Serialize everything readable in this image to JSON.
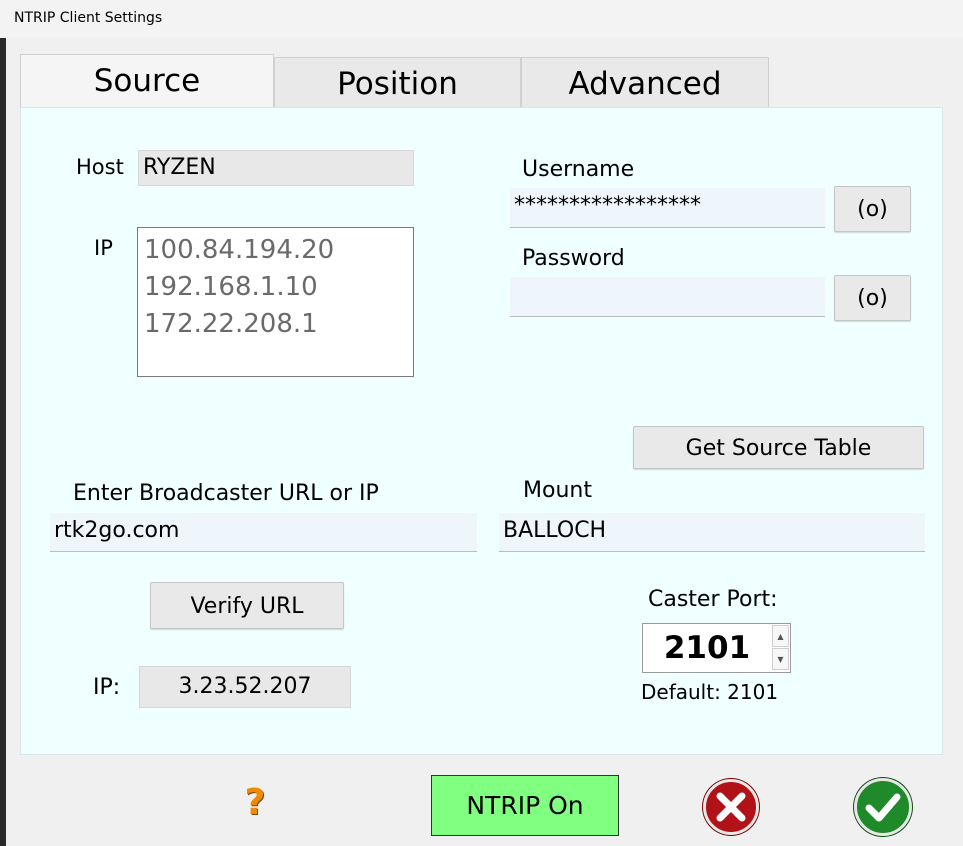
{
  "window": {
    "title": "NTRIP Client Settings"
  },
  "tabs": [
    {
      "label": "Source",
      "active": true
    },
    {
      "label": "Position",
      "active": false
    },
    {
      "label": "Advanced",
      "active": false
    }
  ],
  "source": {
    "host_label": "Host",
    "host_value": "RYZEN",
    "ip_label": "IP",
    "ip_list": [
      "100.84.194.20",
      "192.168.1.10",
      "172.22.208.1"
    ],
    "username_label": "Username",
    "username_value": "*****************",
    "password_label": "Password",
    "password_value": "",
    "reveal_label": "(o)",
    "get_source_table_label": "Get Source Table",
    "broadcaster_label": "Enter Broadcaster URL or IP",
    "broadcaster_value": "rtk2go.com",
    "mount_label": "Mount",
    "mount_value": "BALLOCH",
    "verify_url_label": "Verify URL",
    "resolved_ip_label": "IP:",
    "resolved_ip_value": "3.23.52.207",
    "caster_port_label": "Caster Port:",
    "caster_port_value": "2101",
    "caster_port_default": "Default: 2101"
  },
  "footer": {
    "help_glyph": "?",
    "ntrip_button_label": "NTRIP On",
    "cancel_icon": "red-x-circle-icon",
    "ok_icon": "green-check-circle-icon"
  },
  "colors": {
    "panel_bg": "#f0ffff",
    "ntrip_on_bg": "#80ff80",
    "help_orange": "#f08a00",
    "cancel_red": "#b01218",
    "ok_green": "#1e8a2a"
  }
}
